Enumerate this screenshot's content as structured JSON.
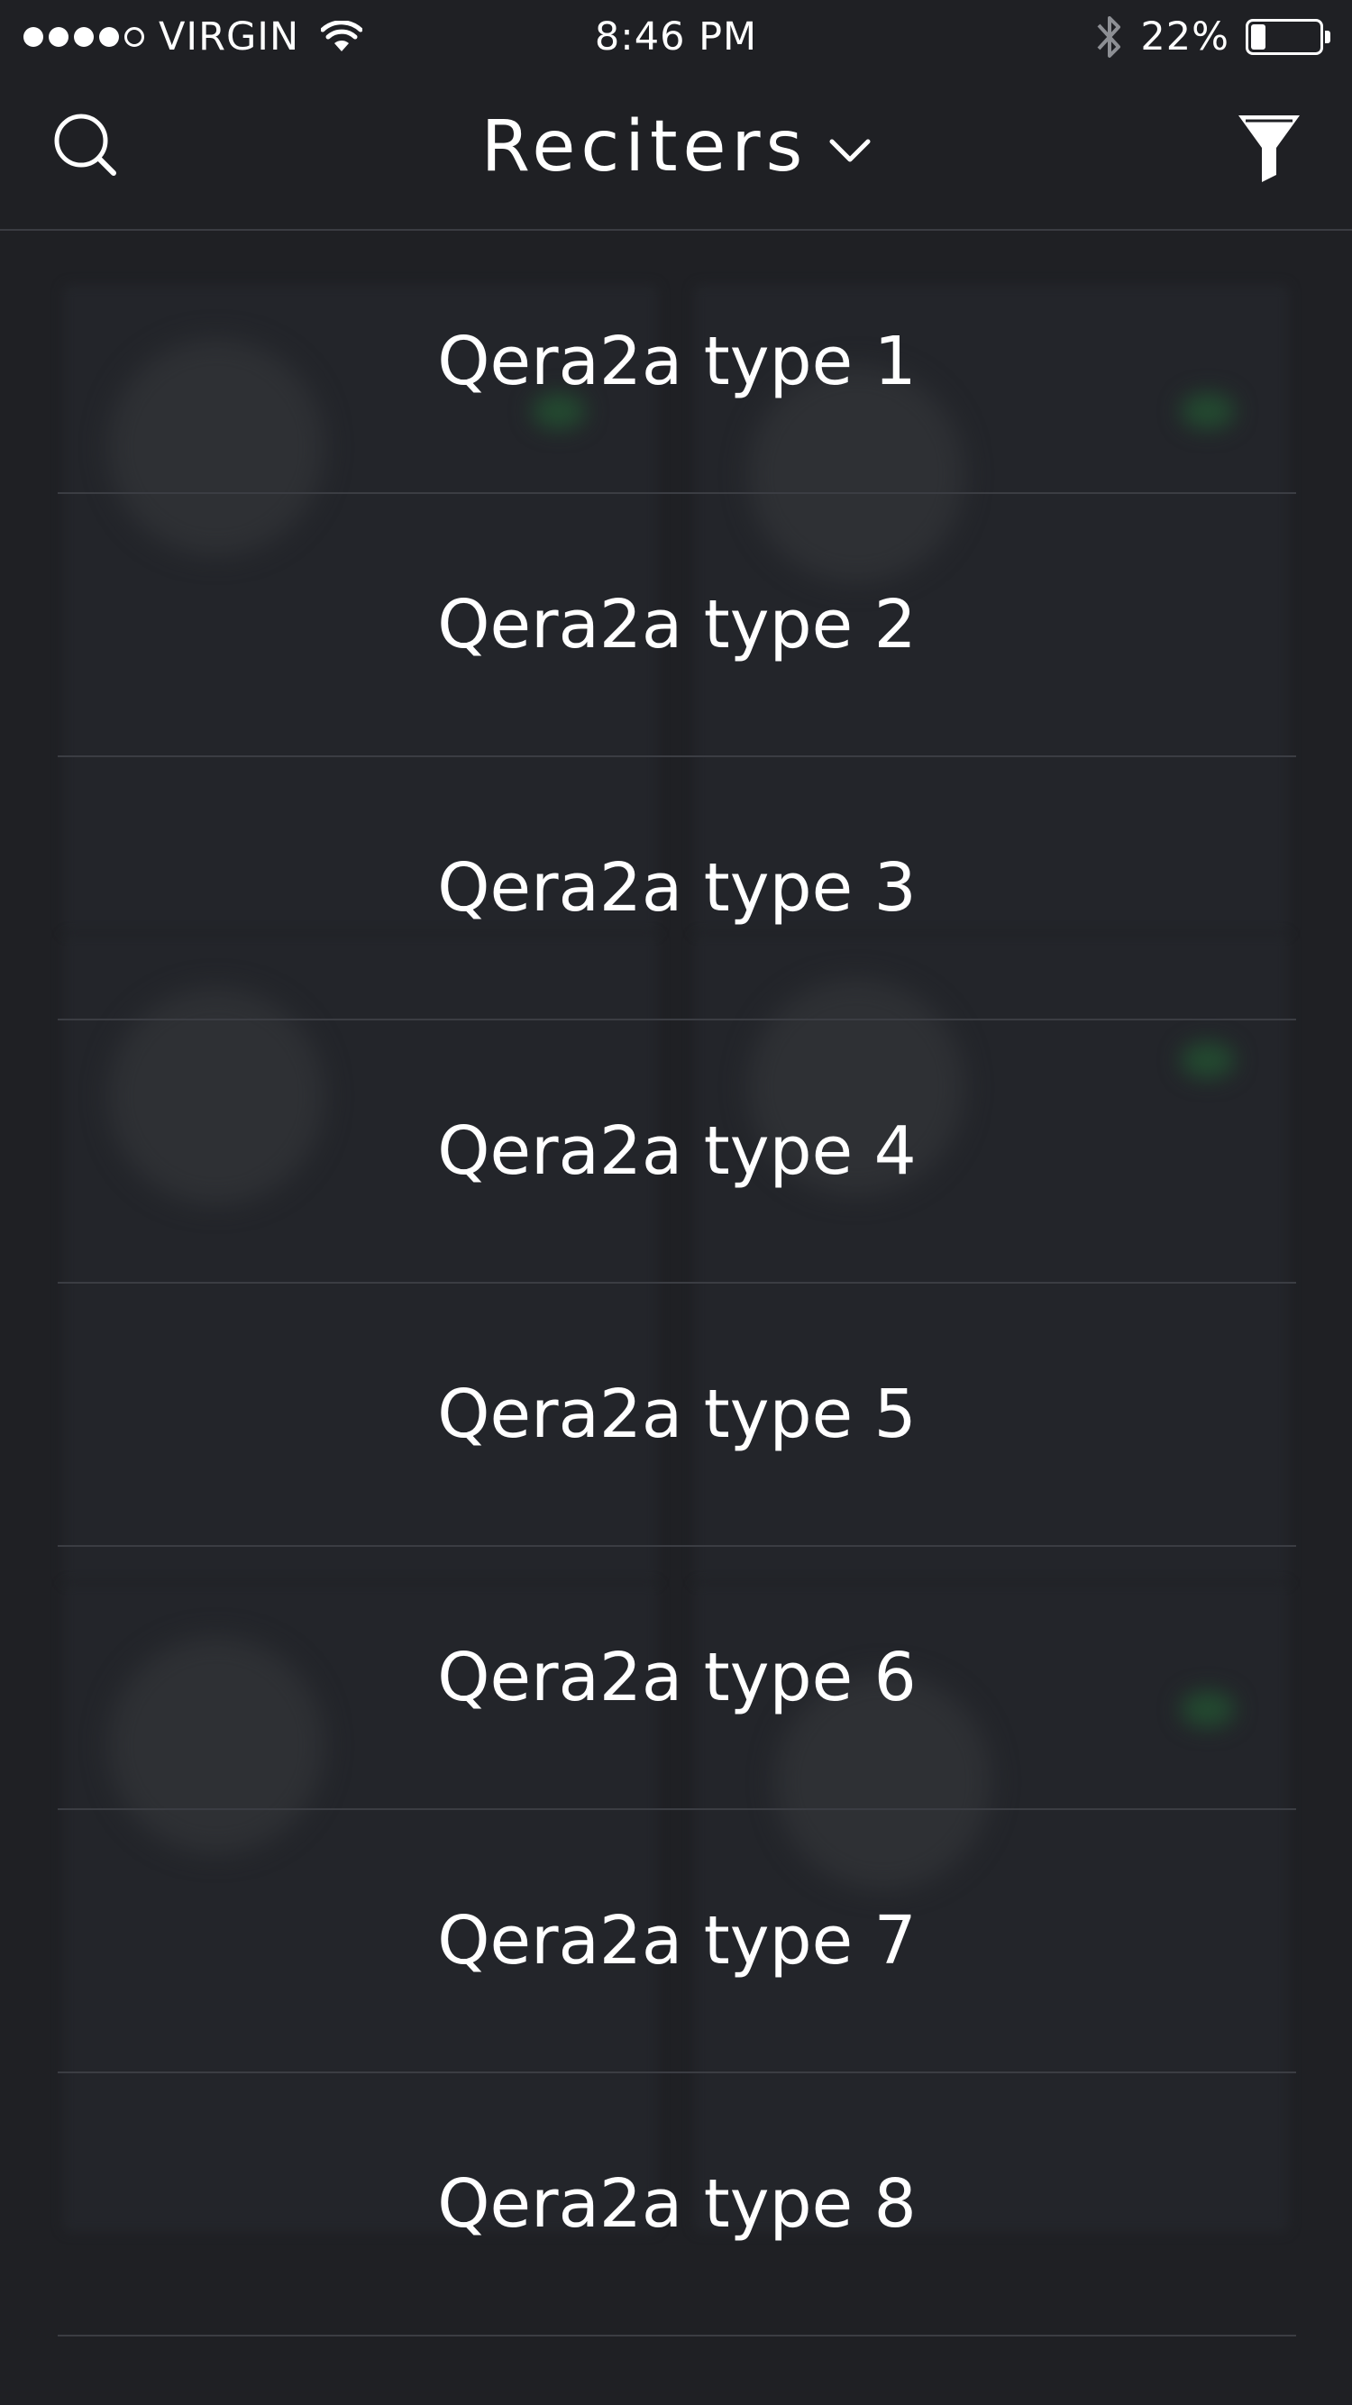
{
  "status_bar": {
    "carrier": "VIRGIN",
    "time": "8:46 PM",
    "battery_percent": "22%",
    "battery_level": 0.22,
    "signal_bars_filled": 4,
    "signal_bars_total": 5,
    "icons": [
      "wifi-icon",
      "bluetooth-icon",
      "battery-icon"
    ]
  },
  "nav_bar": {
    "title": "Reciters",
    "left_icon": "search-icon",
    "title_icon": "chevron-down-icon",
    "right_icon": "filter-icon"
  },
  "menu": {
    "items": [
      {
        "label": "Qera2a type 1"
      },
      {
        "label": "Qera2a type 2"
      },
      {
        "label": "Qera2a type 3"
      },
      {
        "label": "Qera2a type 4"
      },
      {
        "label": "Qera2a type 5"
      },
      {
        "label": "Qera2a type 6"
      },
      {
        "label": "Qera2a type 7"
      },
      {
        "label": "Qera2a type 8"
      }
    ]
  },
  "colors": {
    "background": "#1f2024",
    "divider": "#3b3d43",
    "text": "#ffffff"
  }
}
